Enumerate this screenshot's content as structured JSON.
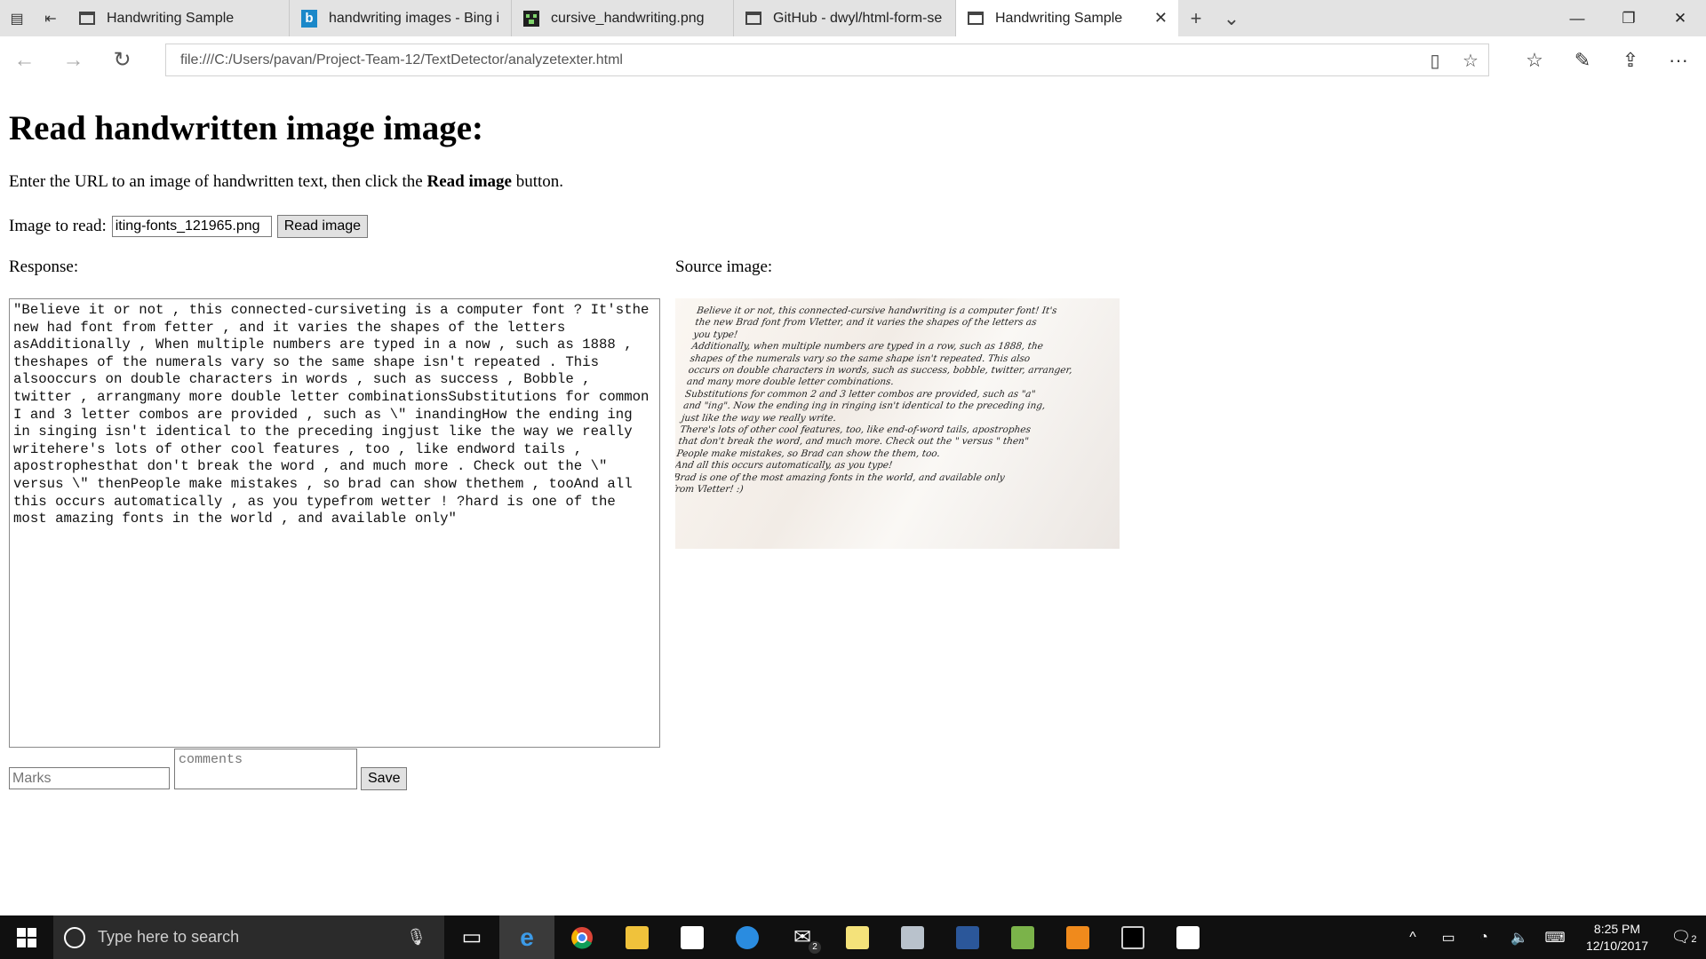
{
  "browser": {
    "tabs": [
      {
        "label": "Handwriting Sample",
        "icon": "page-icon",
        "active": false
      },
      {
        "label": "handwriting images - Bing i",
        "icon": "bing-icon",
        "active": false
      },
      {
        "label": "cursive_handwriting.png",
        "icon": "image-icon",
        "active": false
      },
      {
        "label": "GitHub - dwyl/html-form-se",
        "icon": "page-icon",
        "active": false
      },
      {
        "label": "Handwriting Sample",
        "icon": "page-icon",
        "active": true
      }
    ],
    "address": "file:///C:/Users/pavan/Project-Team-12/TextDetector/analyzetexter.html"
  },
  "page": {
    "title": "Read handwritten image image:",
    "intro_prefix": "Enter the URL to an image of handwritten text, then click the ",
    "intro_bold": "Read image",
    "intro_suffix": " button.",
    "image_label": "Image to read:",
    "image_url_value": "iting-fonts_121965.png",
    "read_button": "Read image",
    "response_label": "Response:",
    "source_label": "Source image:",
    "response_text": "\"Believe it or not , this connected-cursiveting is a computer font ? It'sthe new had font from fetter , and it varies the shapes of the letters asAdditionally , When multiple numbers are typed in a now , such as 1888 , theshapes of the numerals vary so the same shape isn't repeated . This alsooccurs on double characters in words , such as success , Bobble , twitter , arrangmany more double letter combinationsSubstitutions for common I and 3 letter combos are provided , such as \\\" inandingHow the ending ing in singing isn't identical to the preceding ingjust like the way we really writehere's lots of other cool features , too , like endword tails , apostrophesthat don't break the word , and much more . Check out the \\\" versus \\\" thenPeople make mistakes , so brad can show thethem , tooAnd all this occurs automatically , as you typefrom wetter ! ?hard is one of the most amazing fonts in the world , and available only\"",
    "source_image_lines": [
      "Believe it or not, this connected-cursive handwriting is a computer font! It's",
      "the new Brad font from Vletter, and it varies the shapes of the letters as",
      "you type!",
      "Additionally, when multiple numbers are typed in a row, such as 1888, the",
      "shapes of the numerals vary so the same shape isn't repeated. This also",
      "occurs on double characters in words, such as success, bobble, twitter, arranger,",
      "and many more double letter combinations.",
      "Substitutions for common 2 and 3 letter combos are provided, such as \"a\"",
      "and \"ing\". Now the ending ing in ringing isn't identical to the preceding ing,",
      "just like the way we really write.",
      "There's lots of other cool features, too, like end-of-word tails, apostrophes",
      "that don't break the word, and much more. Check out the \" versus \" then\"",
      "People make mistakes, so Brad can show the them, too.",
      "And all this occurs automatically, as you type!",
      "Brad is one of the most amazing fonts in the world, and available only",
      "from Vletter! :)"
    ],
    "marks_placeholder": "Marks",
    "comments_placeholder": "comments",
    "save_button": "Save"
  },
  "taskbar": {
    "search_placeholder": "Type here to search",
    "mail_badge": "2",
    "time": "8:25 PM",
    "date": "12/10/2017",
    "notification_count": "2"
  }
}
